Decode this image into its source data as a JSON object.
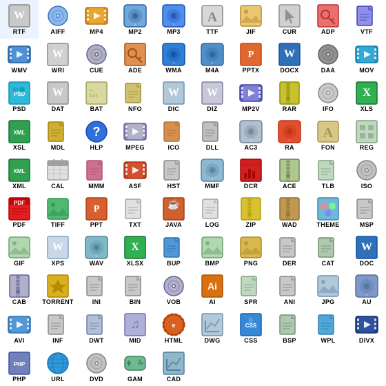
{
  "icons": [
    {
      "label": "RTF",
      "color": "#e0e0e0",
      "bg": "#c8c8c8",
      "text_color": "#444",
      "row": 0
    },
    {
      "label": "AIFF",
      "color": "#70a0e0",
      "bg": "#4080c0",
      "text_color": "#fff",
      "row": 0
    },
    {
      "label": "MP4",
      "color": "#e0a020",
      "bg": "#c08000",
      "text_color": "#fff",
      "row": 0
    },
    {
      "label": "MP2",
      "color": "#80b0e0",
      "bg": "#4080b0",
      "text_color": "#fff",
      "row": 0
    },
    {
      "label": "MP3",
      "color": "#4080e0",
      "bg": "#2060c0",
      "text_color": "#fff",
      "row": 0
    },
    {
      "label": "TTF",
      "color": "#d0d0d0",
      "bg": "#a0a0a0",
      "text_color": "#333",
      "row": 0
    },
    {
      "label": "JIF",
      "color": "#e0c060",
      "bg": "#c09040",
      "text_color": "#fff",
      "row": 0
    },
    {
      "label": "CUR",
      "color": "#c0c0c0",
      "bg": "#909090",
      "text_color": "#333",
      "row": 0
    },
    {
      "label": "ADP",
      "color": "#e06060",
      "bg": "#c03030",
      "text_color": "#fff",
      "row": 0
    },
    {
      "label": "VTF",
      "color": "#8080e0",
      "bg": "#4040c0",
      "text_color": "#fff",
      "row": 0
    },
    {
      "label": "WMV",
      "color": "#60a0e0",
      "bg": "#2060b0",
      "text_color": "#fff",
      "row": 1
    },
    {
      "label": "WRI",
      "color": "#d0d0d0",
      "bg": "#a0a0a0",
      "text_color": "#333",
      "row": 1
    },
    {
      "label": "CUE",
      "color": "#c0c0d0",
      "bg": "#8080a0",
      "text_color": "#fff",
      "row": 1
    },
    {
      "label": "ADE",
      "color": "#e08040",
      "bg": "#c06020",
      "text_color": "#fff",
      "row": 1
    },
    {
      "label": "WMA",
      "color": "#4090e0",
      "bg": "#2070c0",
      "text_color": "#fff",
      "row": 1
    },
    {
      "label": "M4A",
      "color": "#60a0d0",
      "bg": "#4080b0",
      "text_color": "#fff",
      "row": 1
    },
    {
      "label": "PPTX",
      "color": "#e07040",
      "bg": "#c05020",
      "text_color": "#fff",
      "row": 1
    },
    {
      "label": "DOCX",
      "color": "#4080c0",
      "bg": "#2060a0",
      "text_color": "#fff",
      "row": 1
    },
    {
      "label": "DAA",
      "color": "#909090",
      "bg": "#606060",
      "text_color": "#fff",
      "row": 1
    },
    {
      "label": "MOV",
      "color": "#40b0e0",
      "bg": "#2090c0",
      "text_color": "#fff",
      "row": 1
    },
    {
      "label": "PSD",
      "color": "#40c0e0",
      "bg": "#2090c0",
      "text_color": "#fff",
      "row": 2
    },
    {
      "label": "DAT",
      "color": "#d0d0d0",
      "bg": "#a0a0a0",
      "text_color": "#333",
      "row": 2
    },
    {
      "label": "BAT",
      "color": "#e0e0a0",
      "bg": "#c0c060",
      "text_color": "#333",
      "row": 2
    },
    {
      "label": "NFO",
      "color": "#e0c080",
      "bg": "#c0a040",
      "text_color": "#fff",
      "row": 2
    },
    {
      "label": "DIC",
      "color": "#c0d0e0",
      "bg": "#80a0c0",
      "text_color": "#fff",
      "row": 2
    },
    {
      "label": "DIZ",
      "color": "#d0d0e0",
      "bg": "#9090b0",
      "text_color": "#fff",
      "row": 2
    },
    {
      "label": "MP2V",
      "color": "#8080e0",
      "bg": "#4040c0",
      "text_color": "#fff",
      "row": 2
    },
    {
      "label": "RAR",
      "color": "#d0d040",
      "bg": "#a0a000",
      "text_color": "#fff",
      "row": 2
    },
    {
      "label": "IFO",
      "color": "#d0d0d0",
      "bg": "#a0a0a0",
      "text_color": "#333",
      "row": 2
    },
    {
      "label": "XLS",
      "color": "#40c060",
      "bg": "#208040",
      "text_color": "#fff",
      "row": 2
    },
    {
      "label": "XSL",
      "color": "#40a060",
      "bg": "#207040",
      "text_color": "#fff",
      "row": 3
    },
    {
      "label": "MDL",
      "color": "#e0c040",
      "bg": "#c09020",
      "text_color": "#fff",
      "row": 3
    },
    {
      "label": "HLP",
      "color": "#4080e0",
      "bg": "#2060c0",
      "text_color": "#fff",
      "row": 3
    },
    {
      "label": "MPEG",
      "color": "#c0c0d0",
      "bg": "#8080a0",
      "text_color": "#fff",
      "row": 3
    },
    {
      "label": "ICO",
      "color": "#e0a060",
      "bg": "#c08040",
      "text_color": "#fff",
      "row": 3
    },
    {
      "label": "DLL",
      "color": "#c0c0c0",
      "bg": "#909090",
      "text_color": "#333",
      "row": 3
    },
    {
      "label": "AC3",
      "color": "#c0d0e0",
      "bg": "#8090b0",
      "text_color": "#fff",
      "row": 3
    },
    {
      "label": "RA",
      "color": "#e06040",
      "bg": "#c04020",
      "text_color": "#fff",
      "row": 3
    },
    {
      "label": "FON",
      "color": "#e0d0a0",
      "bg": "#c0a060",
      "text_color": "#333",
      "row": 3
    },
    {
      "label": "REG",
      "color": "#d0e0d0",
      "bg": "#90b090",
      "text_color": "#333",
      "row": 3
    },
    {
      "label": "XML",
      "color": "#40b060",
      "bg": "#208040",
      "text_color": "#fff",
      "row": 4
    },
    {
      "label": "CAL",
      "color": "#e0e0e0",
      "bg": "#b0b0b0",
      "text_color": "#333",
      "row": 4
    },
    {
      "label": "MMM",
      "color": "#e080a0",
      "bg": "#c06080",
      "text_color": "#fff",
      "row": 4
    },
    {
      "label": "ASF",
      "color": "#e06040",
      "bg": "#c04020",
      "text_color": "#fff",
      "row": 4
    },
    {
      "label": "HST",
      "color": "#d0d0d0",
      "bg": "#a0a0a0",
      "text_color": "#333",
      "row": 4
    },
    {
      "label": "MMF",
      "color": "#a0c0e0",
      "bg": "#6090b0",
      "text_color": "#fff",
      "row": 4
    },
    {
      "label": "DCR",
      "color": "#e04040",
      "bg": "#c02020",
      "text_color": "#fff",
      "row": 4
    },
    {
      "label": "ACE",
      "color": "#c0d0a0",
      "bg": "#809060",
      "text_color": "#fff",
      "row": 4
    },
    {
      "label": "TLB",
      "color": "#d0e0d0",
      "bg": "#90b090",
      "text_color": "#333",
      "row": 4
    },
    {
      "label": "ISO",
      "color": "#c0c0c0",
      "bg": "#909090",
      "text_color": "#333",
      "row": 4
    },
    {
      "label": "PDF",
      "color": "#e03030",
      "bg": "#c01010",
      "text_color": "#fff",
      "row": 5
    },
    {
      "label": "TIFF",
      "color": "#60c080",
      "bg": "#40a060",
      "text_color": "#fff",
      "row": 5
    },
    {
      "label": "PPT",
      "color": "#e07040",
      "bg": "#c05020",
      "text_color": "#fff",
      "row": 5
    },
    {
      "label": "TXT",
      "color": "#e0e0e0",
      "bg": "#b0b0b0",
      "text_color": "#333",
      "row": 5
    },
    {
      "label": "JAVA",
      "color": "#e07040",
      "bg": "#c05020",
      "text_color": "#fff",
      "row": 5
    },
    {
      "label": "LOG",
      "color": "#e0e0e0",
      "bg": "#b0b0b0",
      "text_color": "#333",
      "row": 5
    },
    {
      "label": "ZIP",
      "color": "#e0d060",
      "bg": "#c0b020",
      "text_color": "#fff",
      "row": 5
    },
    {
      "label": "WAD",
      "color": "#c0a060",
      "bg": "#907040",
      "text_color": "#fff",
      "row": 5
    },
    {
      "label": "THEME",
      "color": "#80c0e0",
      "bg": "#4090c0",
      "text_color": "#fff",
      "row": 5
    },
    {
      "label": "MSP",
      "color": "#d0d0d0",
      "bg": "#a0a0a0",
      "text_color": "#333",
      "row": 5
    },
    {
      "label": "GIF",
      "color": "#c0e0c0",
      "bg": "#80b080",
      "text_color": "#333",
      "row": 6
    },
    {
      "label": "XPS",
      "color": "#d0e0f0",
      "bg": "#90b0d0",
      "text_color": "#333",
      "row": 6
    },
    {
      "label": "WAV",
      "color": "#90c0d0",
      "bg": "#6090a0",
      "text_color": "#fff",
      "row": 6
    },
    {
      "label": "XLSX",
      "color": "#40c060",
      "bg": "#208040",
      "text_color": "#fff",
      "row": 6
    },
    {
      "label": "BUP",
      "color": "#60a0e0",
      "bg": "#4080c0",
      "text_color": "#fff",
      "row": 6
    },
    {
      "label": "BMP",
      "color": "#c0e0c0",
      "bg": "#80b080",
      "text_color": "#333",
      "row": 6
    },
    {
      "label": "PNG",
      "color": "#e0c060",
      "bg": "#c09040",
      "text_color": "#fff",
      "row": 6
    },
    {
      "label": "DER",
      "color": "#d0d0d0",
      "bg": "#a0a0a0",
      "text_color": "#333",
      "row": 6
    },
    {
      "label": "CAT",
      "color": "#c0d0c0",
      "bg": "#809080",
      "text_color": "#333",
      "row": 6
    },
    {
      "label": "DOC",
      "color": "#4080c0",
      "bg": "#2060a0",
      "text_color": "#fff",
      "row": 6
    },
    {
      "label": "CAB",
      "color": "#c0c0d0",
      "bg": "#8080a0",
      "text_color": "#fff",
      "row": 7
    },
    {
      "label": "TORRENT",
      "color": "#e0c040",
      "bg": "#c09020",
      "text_color": "#fff",
      "row": 7
    },
    {
      "label": "INI",
      "color": "#d0d0d0",
      "bg": "#a0a0a0",
      "text_color": "#333",
      "row": 7
    },
    {
      "label": "BIN",
      "color": "#d0d0d0",
      "bg": "#a0a0a0",
      "text_color": "#333",
      "row": 7
    },
    {
      "label": "VOB",
      "color": "#c0c0d0",
      "bg": "#8080a0",
      "text_color": "#fff",
      "row": 7
    },
    {
      "label": "AI",
      "color": "#e08020",
      "bg": "#c06000",
      "text_color": "#fff",
      "row": 7
    },
    {
      "label": "SPR",
      "color": "#d0e0d0",
      "bg": "#90b090",
      "text_color": "#333",
      "row": 7
    },
    {
      "label": "ANI",
      "color": "#d0d0d0",
      "bg": "#a0a0a0",
      "text_color": "#333",
      "row": 7
    },
    {
      "label": "JPG",
      "color": "#c0d0e0",
      "bg": "#80a0c0",
      "text_color": "#fff",
      "row": 7
    },
    {
      "label": "AU",
      "color": "#90b0d0",
      "bg": "#6090b0",
      "text_color": "#fff",
      "row": 7
    },
    {
      "label": "AVI",
      "color": "#60a0e0",
      "bg": "#4080c0",
      "text_color": "#fff",
      "row": 8
    },
    {
      "label": "INF",
      "color": "#d0d0d0",
      "bg": "#a0a0a0",
      "text_color": "#333",
      "row": 8
    },
    {
      "label": "DWT",
      "color": "#c0d0e0",
      "bg": "#8090b0",
      "text_color": "#fff",
      "row": 8
    },
    {
      "label": "MID",
      "color": "#c0c0e0",
      "bg": "#8080b0",
      "text_color": "#fff",
      "row": 8
    },
    {
      "label": "HTML",
      "color": "#e07030",
      "bg": "#c05010",
      "text_color": "#fff",
      "row": 8
    },
    {
      "label": "DWG",
      "color": "#c0d0e0",
      "bg": "#8090b0",
      "text_color": "#fff",
      "row": 8
    },
    {
      "label": "CSS",
      "color": "#4090e0",
      "bg": "#2070c0",
      "text_color": "#fff",
      "row": 8
    },
    {
      "label": "BSP",
      "color": "#c0d0c0",
      "bg": "#80a080",
      "text_color": "#333",
      "row": 8
    },
    {
      "label": "WPL",
      "color": "#60b0e0",
      "bg": "#4090c0",
      "text_color": "#fff",
      "row": 8
    },
    {
      "label": "DIVX",
      "color": "#4060a0",
      "bg": "#204080",
      "text_color": "#fff",
      "row": 8
    },
    {
      "label": "PHP",
      "color": "#8090c0",
      "bg": "#5060a0",
      "text_color": "#fff",
      "row": 9
    },
    {
      "label": "URL",
      "color": "#40a0e0",
      "bg": "#2080c0",
      "text_color": "#fff",
      "row": 9
    },
    {
      "label": "DVD",
      "color": "#c0c0c0",
      "bg": "#909090",
      "text_color": "#333",
      "row": 9
    },
    {
      "label": "GAM",
      "color": "#80c0a0",
      "bg": "#509070",
      "text_color": "#fff",
      "row": 9
    },
    {
      "label": "CAD",
      "color": "#c0d0e0",
      "bg": "#7090b0",
      "text_color": "#fff",
      "row": 9
    }
  ]
}
